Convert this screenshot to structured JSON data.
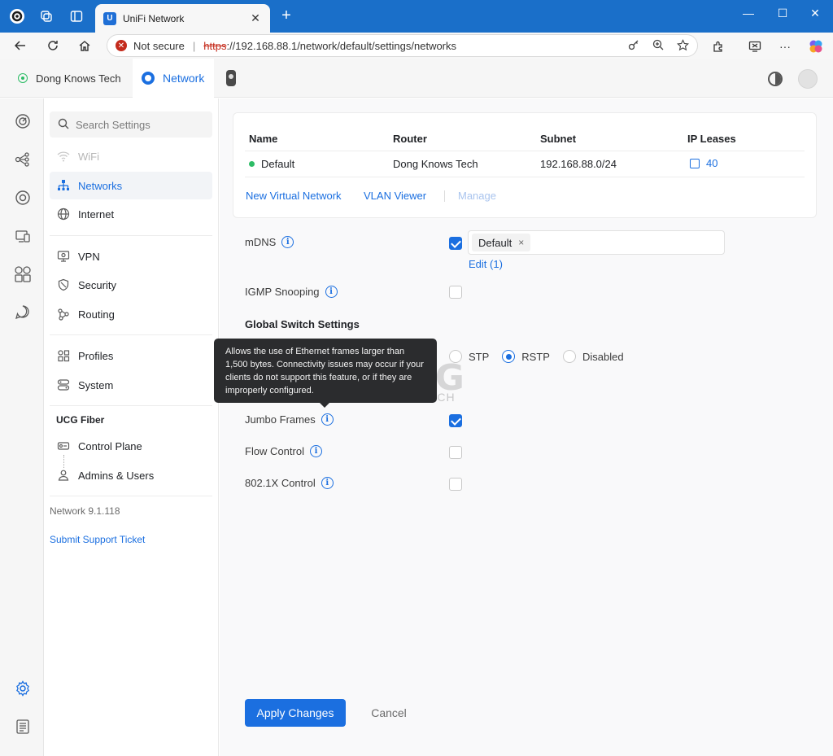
{
  "browser": {
    "tab_title": "UniFi Network",
    "tab_favicon": "U",
    "new_tab_symbol": "+",
    "close_symbol": "✕",
    "url_security": "Not secure",
    "url_scheme": "https",
    "url_rest": "://192.168.88.1/network/default/settings/networks",
    "window_controls": [
      "—",
      "☐",
      "✕"
    ]
  },
  "app": {
    "site_name": "Dong Knows Tech",
    "app_name": "Network"
  },
  "nav": {
    "search_placeholder": "Search Settings",
    "items": [
      {
        "label": "WiFi",
        "icon": "wifi-icon"
      },
      {
        "label": "Networks",
        "icon": "networks-icon"
      },
      {
        "label": "Internet",
        "icon": "globe-icon"
      },
      {
        "label": "VPN",
        "icon": "vpn-icon"
      },
      {
        "label": "Security",
        "icon": "shield-icon"
      },
      {
        "label": "Routing",
        "icon": "routing-icon"
      },
      {
        "label": "Profiles",
        "icon": "profiles-icon"
      },
      {
        "label": "System",
        "icon": "system-icon"
      },
      {
        "label": "Control Plane",
        "icon": "control-plane-icon"
      },
      {
        "label": "Admins & Users",
        "icon": "admins-icon"
      }
    ],
    "section_ucg": "UCG Fiber",
    "version": "Network 9.1.118",
    "support_link": "Submit Support Ticket"
  },
  "networks_table": {
    "headers": [
      "Name",
      "Router",
      "Subnet",
      "IP Leases"
    ],
    "rows": [
      {
        "name": "Default",
        "router": "Dong Knows Tech",
        "subnet": "192.168.88.0/24",
        "leases": "40"
      }
    ],
    "links": {
      "new_virtual_network": "New Virtual Network",
      "vlan_viewer": "VLAN Viewer",
      "manage": "Manage"
    }
  },
  "settings": {
    "mdns_label": "mDNS",
    "mdns_chip": "Default",
    "chip_remove": "×",
    "mdns_edit": "Edit (1)",
    "igmp_label": "IGMP Snooping",
    "global_switch_title": "Global Switch Settings",
    "stp_options": [
      "STP",
      "RSTP",
      "Disabled"
    ],
    "stp_selected": "RSTP",
    "jumbo_label": "Jumbo Frames",
    "flow_label": "Flow Control",
    "dot1x_label": "802.1X Control",
    "info_glyph": "i",
    "tooltip": "Allows the use of Ethernet frames larger than 1,500 bytes. Connectivity issues may occur if your clients do not support this feature, or if they are improperly configured."
  },
  "watermark": {
    "main": "DONG",
    "sub": "KNOWS TECH"
  },
  "actions": {
    "apply": "Apply Changes",
    "cancel": "Cancel"
  },
  "colors": {
    "accent": "#1b6fe0",
    "browser_bar": "#1a6fc9",
    "online": "#2dbc66",
    "insecure": "#c42b1c"
  }
}
